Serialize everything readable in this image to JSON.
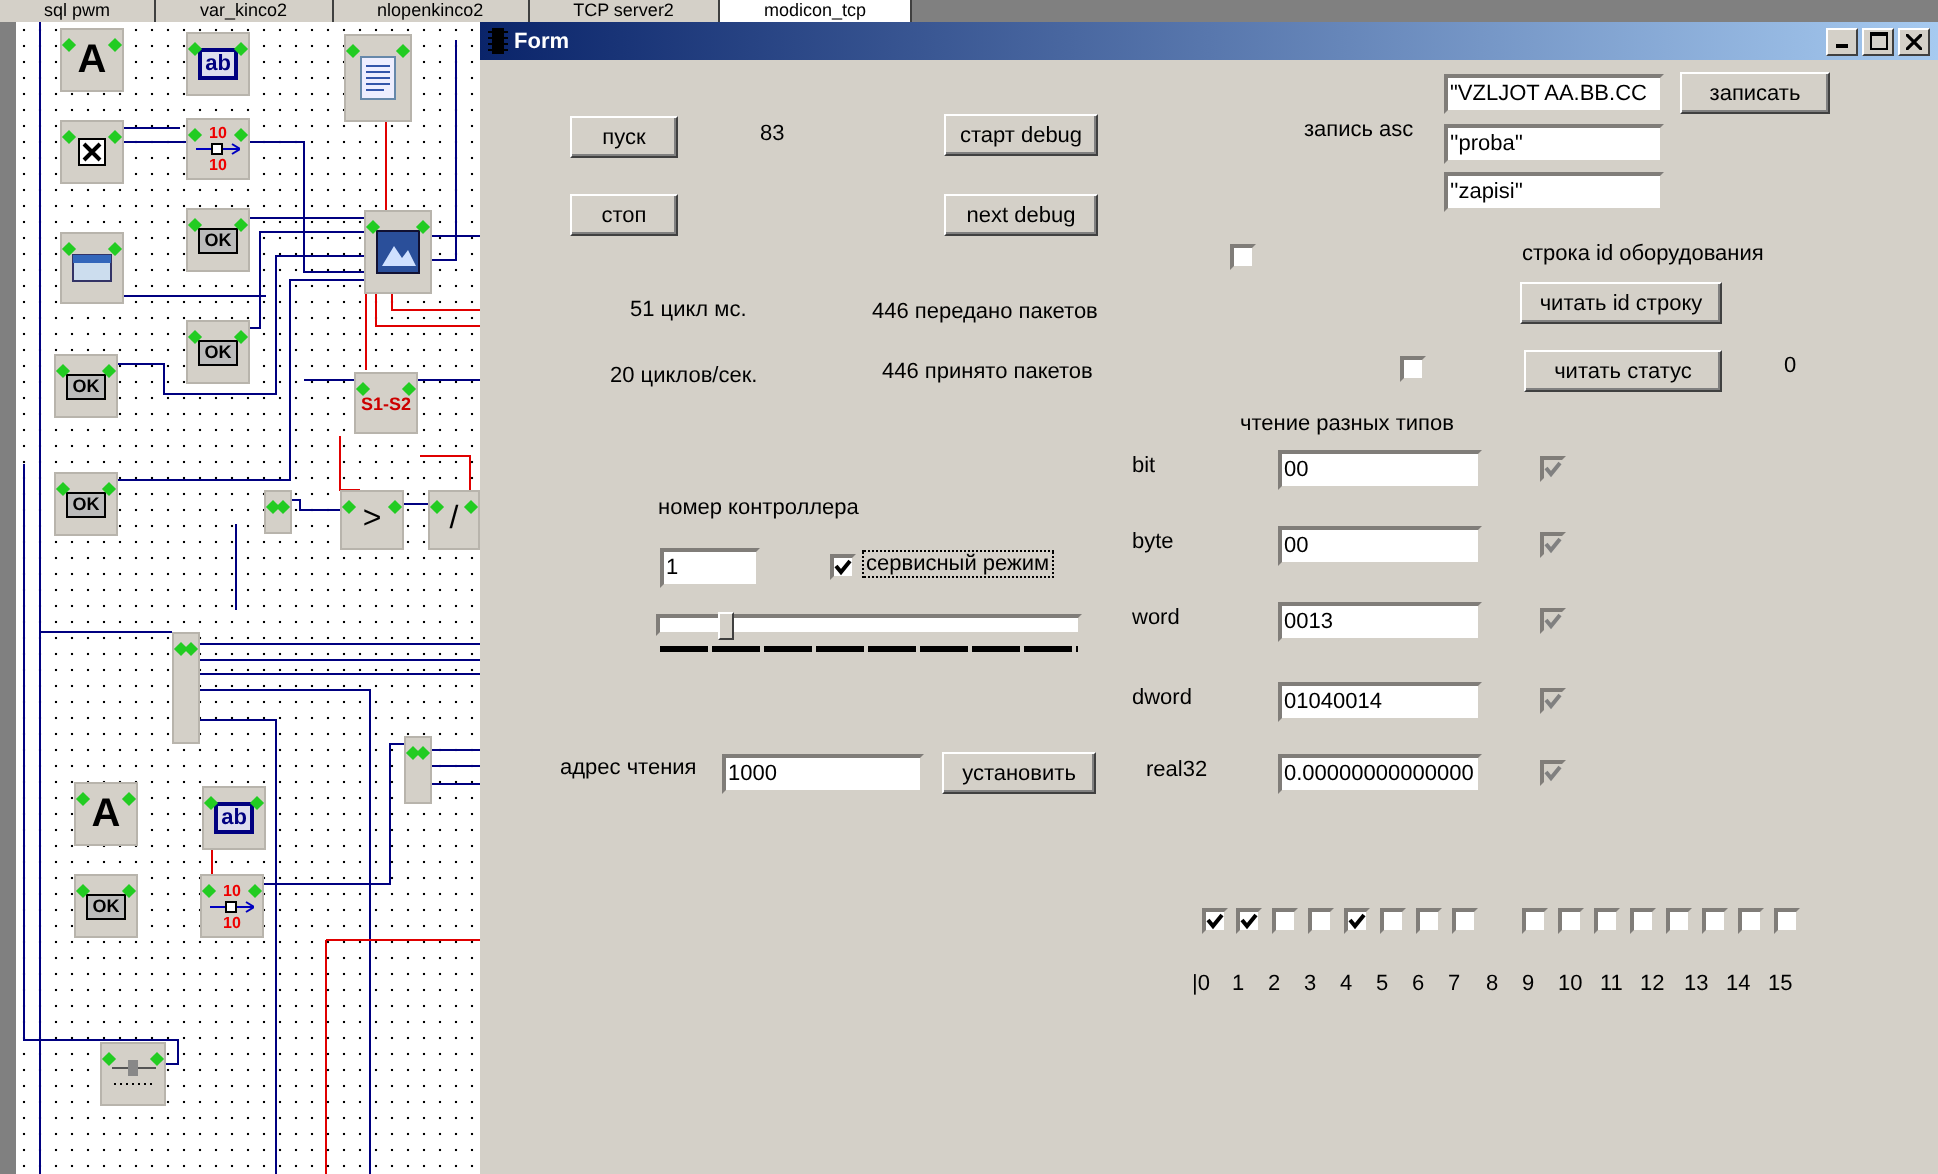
{
  "tabs": [
    {
      "label": "sql pwm",
      "selected": false
    },
    {
      "label": "var_kinco2",
      "selected": false
    },
    {
      "label": "nlopenkinco2",
      "selected": false
    },
    {
      "label": "TCP server2",
      "selected": false
    },
    {
      "label": "modicon_tcp",
      "selected": true
    }
  ],
  "diagram": {
    "blocks": [
      {
        "kind": "label",
        "text": "A"
      },
      {
        "kind": "edit",
        "text": "ab"
      },
      {
        "kind": "memo"
      },
      {
        "kind": "checkbox"
      },
      {
        "kind": "converter",
        "texts": [
          "10",
          "10"
        ]
      },
      {
        "kind": "button",
        "text": "OK"
      },
      {
        "kind": "window"
      },
      {
        "kind": "image"
      },
      {
        "kind": "button",
        "text": "OK"
      },
      {
        "kind": "button",
        "text": "OK"
      },
      {
        "kind": "subtract",
        "text": "S1-S2"
      },
      {
        "kind": "button",
        "text": "OK"
      },
      {
        "kind": "bus"
      },
      {
        "kind": "operator",
        "text": ">"
      },
      {
        "kind": "operator",
        "text": "/"
      },
      {
        "kind": "bus"
      },
      {
        "kind": "bus"
      },
      {
        "kind": "label",
        "text": "A"
      },
      {
        "kind": "edit",
        "text": "ab"
      },
      {
        "kind": "button",
        "text": "OK"
      },
      {
        "kind": "converter",
        "texts": [
          "10",
          "10"
        ]
      },
      {
        "kind": "slider"
      }
    ]
  },
  "form": {
    "title": "Form",
    "start_button": "пуск",
    "counter": "83",
    "debug_start_button": "старт debug",
    "stop_button": "стоп",
    "debug_next_button": "next debug",
    "asc_label": "запись asc",
    "asc_fields": [
      "\"VZLJOT AA.BB.CC",
      "''proba''",
      "''zapisi''"
    ],
    "write_button": "записать",
    "id_checkbox": {
      "checked": false
    },
    "id_label": "строка id оборудования",
    "read_id_button": "читать id строку",
    "stats": [
      "51 цикл мс.",
      "446 передано пакетов",
      "20 циклов/сек.",
      "446 принято пакетов"
    ],
    "status_checkbox": {
      "checked": false
    },
    "read_status_button": "читать статус",
    "status_value": "0",
    "types_title": "чтение разных типов",
    "types": [
      {
        "label": "bit",
        "value": "00",
        "checked": true,
        "disabled": true
      },
      {
        "label": "byte",
        "value": "00",
        "checked": true,
        "disabled": true
      },
      {
        "label": "word",
        "value": "0013",
        "checked": true,
        "disabled": true
      },
      {
        "label": "dword",
        "value": "01040014",
        "checked": true,
        "disabled": true
      },
      {
        "label": "real32",
        "value": "0.00000000000000",
        "checked": true,
        "disabled": true
      }
    ],
    "controller_label": "номер контроллера",
    "controller_value": "1",
    "service_mode": {
      "label": "сервисный режим",
      "checked": true
    },
    "slider": {
      "level": 0.16
    },
    "address_label": "адрес чтения",
    "address_value": "1000",
    "set_button": "установить",
    "bit_checkboxes": [
      {
        "checked": true
      },
      {
        "checked": true
      },
      {
        "checked": false
      },
      {
        "checked": false
      },
      {
        "checked": true
      },
      {
        "checked": false
      },
      {
        "checked": false
      },
      {
        "checked": false
      },
      {
        "checked": false
      },
      {
        "checked": false
      },
      {
        "checked": false
      },
      {
        "checked": false
      },
      {
        "checked": false
      },
      {
        "checked": false
      },
      {
        "checked": false
      },
      {
        "checked": false
      }
    ],
    "bit_labels": [
      "|0",
      "1",
      "2",
      "3",
      "4",
      "5",
      "6",
      "7",
      "8",
      "9",
      "10",
      "11",
      "12",
      "13",
      "14",
      "15"
    ]
  }
}
